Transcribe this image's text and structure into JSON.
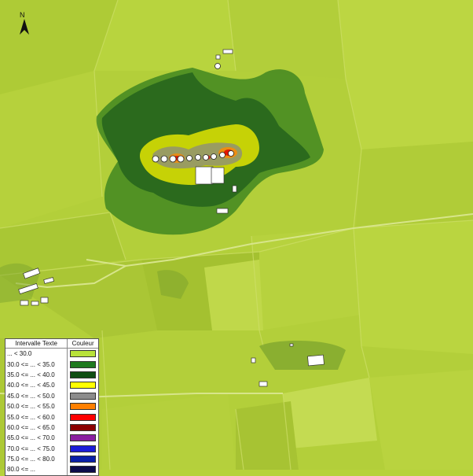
{
  "compass": {
    "label": "N",
    "icon": "north-arrow-icon"
  },
  "legend": {
    "header_interval": "Intervalle Texte",
    "header_color": "Couleur",
    "items": [
      {
        "label": "... < 30.0",
        "color": "#b8e23a"
      },
      {
        "label": "30.0 <= ... < 35.0",
        "color": "#1f7a1f"
      },
      {
        "label": "35.0 <= ... < 40.0",
        "color": "#0f4f12"
      },
      {
        "label": "40.0 <= ... < 45.0",
        "color": "#ffff00"
      },
      {
        "label": "45.0 <= ... < 50.0",
        "color": "#8c8c8c"
      },
      {
        "label": "50.0 <= ... < 55.0",
        "color": "#ff8000"
      },
      {
        "label": "55.0 <= ... < 60.0",
        "color": "#ff0000"
      },
      {
        "label": "60.0 <= ... < 65.0",
        "color": "#8b0000"
      },
      {
        "label": "65.0 <= ... < 70.0",
        "color": "#8a1fa0"
      },
      {
        "label": "70.0 <= ... < 75.0",
        "color": "#1c1cd9"
      },
      {
        "label": "75.0 <= ... < 80.0",
        "color": "#0a1fa8"
      },
      {
        "label": "80.0 <= ...",
        "color": "#0c0c4a"
      }
    ]
  }
}
